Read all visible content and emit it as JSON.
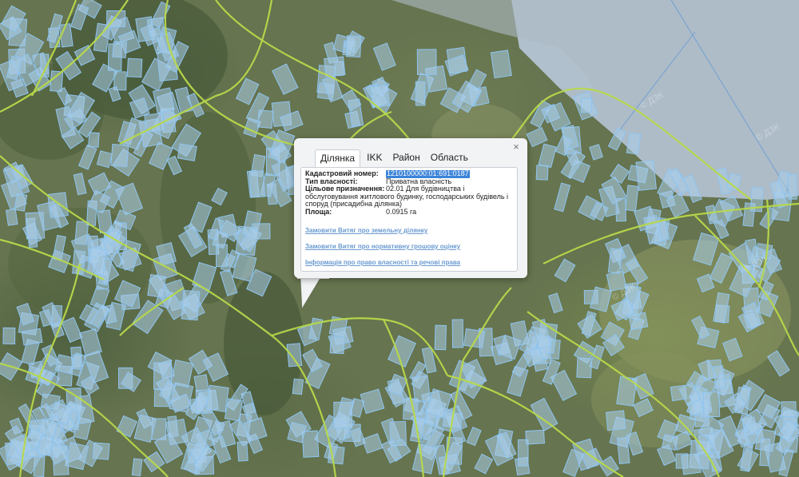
{
  "popup": {
    "close_symbol": "×",
    "tabs": [
      {
        "label": "Ділянка",
        "active": true
      },
      {
        "label": "IKK",
        "active": false
      },
      {
        "label": "Район",
        "active": false
      },
      {
        "label": "Область",
        "active": false
      }
    ],
    "fields": {
      "cadastral_label": "Кадастровий номер:",
      "cadastral_value": "1210100000:01:691:0187",
      "ownership_label": "Тип власності:",
      "ownership_value": "Приватна власність",
      "purpose_label": "Цільове призначення:",
      "purpose_value": "02.01 Для будівництва і обслуговування житлового будинку, господарських будівель і споруд (присадибна ділянка)",
      "area_label": "Площа:",
      "area_value": "0.0915 га"
    },
    "links": {
      "order_extract": "Замовити Витяг про земельну ділянку",
      "order_valuation": "Замовити Витяг про нормативну грошову оцінку",
      "rights_info": "Інформація про право власності та речові права"
    }
  },
  "map": {
    "watermark": "© ДЗК",
    "colors": {
      "parcel_fill": "#a9cdea",
      "parcel_stroke": "#8fc4ef",
      "road": "#b7d84a",
      "state_land": "#b4c2d2"
    }
  }
}
